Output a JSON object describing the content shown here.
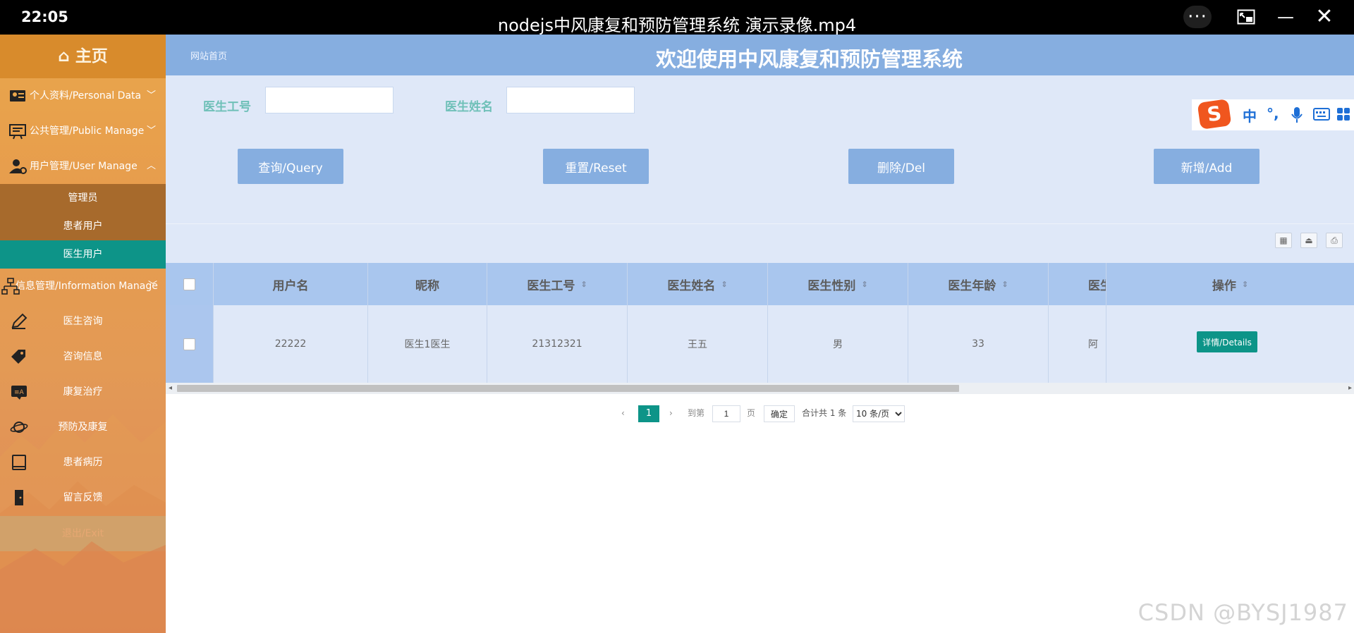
{
  "player": {
    "clock": "22:05",
    "title": "nodejs中风康复和预防管理系统 演示录像.mp4",
    "more_icon": "more-icon",
    "pip_icon": "picture-in-picture-icon",
    "minimize_icon": "minimize-icon",
    "close_icon": "close-icon"
  },
  "sidebar": {
    "home_label": "⌂ 主页",
    "groups": [
      {
        "label": "个人资料/Personal Data",
        "icon": "user-card-icon",
        "expanded": false
      },
      {
        "label": "公共管理/Public Manage",
        "icon": "board-icon",
        "expanded": false
      },
      {
        "label": "用户管理/User Manage",
        "icon": "user-gear-icon",
        "expanded": true
      },
      {
        "label": "信息管理/Information Manage",
        "icon": "org-tree-icon",
        "expanded": true
      }
    ],
    "user_sub": [
      {
        "label": "管理员",
        "active": false
      },
      {
        "label": "患者用户",
        "active": false
      },
      {
        "label": "医生用户",
        "active": true
      }
    ],
    "info_items": [
      {
        "label": "医生咨询",
        "icon": "pen-icon"
      },
      {
        "label": "咨询信息",
        "icon": "tag-icon"
      },
      {
        "label": "康复治疗",
        "icon": "translate-icon"
      },
      {
        "label": "预防及康复",
        "icon": "planet-icon"
      },
      {
        "label": "患者病历",
        "icon": "book-icon"
      },
      {
        "label": "留言反馈",
        "icon": "door-icon"
      }
    ],
    "exit_label": "退出/Exit"
  },
  "header": {
    "breadcrumb": "网站首页",
    "welcome": "欢迎使用中风康复和预防管理系统"
  },
  "search": {
    "doctor_id_label": "医生工号",
    "doctor_id_value": "",
    "doctor_name_label": "医生姓名",
    "doctor_name_value": ""
  },
  "actions": {
    "query": "查询/Query",
    "reset": "重置/Reset",
    "delete": "删除/Del",
    "add": "新增/Add"
  },
  "ime": {
    "logo": "S",
    "lang": "中",
    "punct": "°,",
    "mic_icon": "microphone-icon",
    "keyboard_icon": "keyboard-icon",
    "apps_icon": "apps-grid-icon"
  },
  "table": {
    "columns": [
      "用户名",
      "昵称",
      "医生工号",
      "医生姓名",
      "医生性别",
      "医生年龄",
      "医生"
    ],
    "op_column": "操作",
    "rows": [
      {
        "username": "22222",
        "nickname": "医生1医生",
        "doctor_id": "21312321",
        "doctor_name": "王五",
        "gender": "男",
        "age": "33",
        "partial": "阿"
      }
    ],
    "detail_button": "详情/Details"
  },
  "pagination": {
    "current_page": "1",
    "goto_label": "到第",
    "goto_value": "1",
    "page_unit": "页",
    "confirm": "确定",
    "total": "合计共 1 条",
    "page_size": "10 条/页"
  },
  "watermark": "CSDN @BYSJ1987"
}
